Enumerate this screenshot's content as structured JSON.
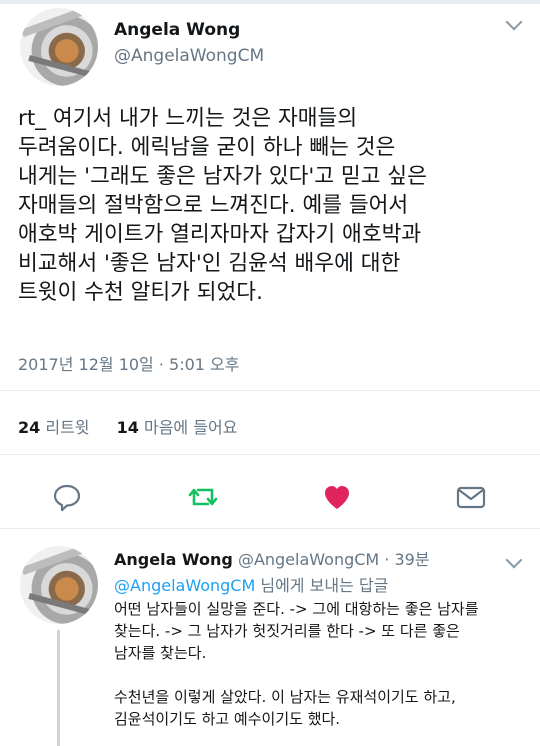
{
  "main": {
    "name": "Angela Wong",
    "handle": "@AngelaWongCM",
    "body": "rt_ 여기서 내가 느끼는 것은 자매들의\n두려움이다. 에릭남을 굳이 하나 빼는 것은\n내게는 '그래도 좋은 남자가 있다'고 믿고 싶은\n자매들의 절박함으로 느껴진다. 예를 들어서\n애호박 게이트가 열리자마자 갑자기 애호박과\n비교해서 '좋은 남자'인 김윤석 배우에 대한\n트윗이 수천 알티가 되었다.",
    "timestamp": "2017년 12월 10일 · 5:01 오후",
    "retweets_count": "24",
    "retweets_label": "리트윗",
    "likes_count": "14",
    "likes_label": "마음에 들어요"
  },
  "actions": {
    "reply_icon": "reply-icon",
    "retweet_icon": "retweet-icon",
    "like_icon": "heart-icon",
    "dm_icon": "mail-icon",
    "retweet_color": "#17bf63",
    "like_color": "#e0245e"
  },
  "reply": {
    "name": "Angela Wong",
    "handle_time": "@AngelaWongCM · 39분",
    "mention": "@AngelaWongCM",
    "replying_suffix": " 님에게 보내는 답글",
    "body": "어떤 남자들이 실망을 준다. -> 그에 대항하는 좋은 남자를\n찾는다. -> 그 남자가 헛짓거리를 한다 -> 또 다른 좋은\n남자를 찾는다.\n\n수천년을 이렇게 살았다. 이 남자는 유재석이기도 하고,\n김윤석이기도 하고 예수이기도 했다."
  }
}
